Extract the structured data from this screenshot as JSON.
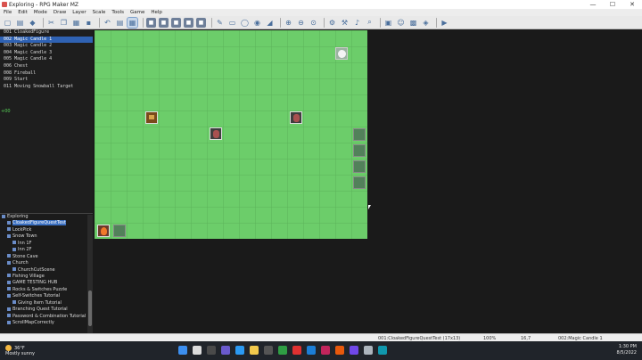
{
  "window": {
    "title": "Exploring - RPG Maker MZ",
    "controls": [
      "—",
      "☐",
      "✕"
    ]
  },
  "menu": [
    "File",
    "Edit",
    "Mode",
    "Draw",
    "Layer",
    "Scale",
    "Tools",
    "Game",
    "Help"
  ],
  "events": [
    "001 CloakedFigure",
    "002 Magic Candle 1",
    "003 Magic Candle 2",
    "004 Magic Candle 3",
    "005 Magic Candle 4",
    "006 Chest",
    "008 Fireball",
    "009 Start",
    "011 Moving Snowball Target"
  ],
  "green_marker": "+00",
  "maps": [
    {
      "label": "Exploring",
      "indent": 0
    },
    {
      "label": "CloakedFigureQuestTest",
      "indent": 1,
      "selected": true
    },
    {
      "label": "LockPick",
      "indent": 1
    },
    {
      "label": "Snow Town",
      "indent": 1
    },
    {
      "label": "Inn 1F",
      "indent": 2
    },
    {
      "label": "Inn 2F",
      "indent": 2
    },
    {
      "label": "Stone Cave",
      "indent": 1
    },
    {
      "label": "Church",
      "indent": 1
    },
    {
      "label": "ChurchCutScene",
      "indent": 2
    },
    {
      "label": "Fishing Village",
      "indent": 1
    },
    {
      "label": "GAME TESTING HUB",
      "indent": 1
    },
    {
      "label": "Rocks & Switches Puzzle",
      "indent": 1
    },
    {
      "label": "Self-Switches Tutorial",
      "indent": 1
    },
    {
      "label": "Giving Item Tutorial",
      "indent": 2
    },
    {
      "label": "Branching Quest Tutorial",
      "indent": 1
    },
    {
      "label": "Password & Combination Tutorial",
      "indent": 1
    },
    {
      "label": "ScrollMapCorrectly",
      "indent": 1
    }
  ],
  "status": {
    "map": "001:CloakedFigureQuestTest (17x13)",
    "zoom": "100%",
    "coords": "16,7",
    "event": "002:Magic Candle 1"
  },
  "weather": {
    "temp": "36°F",
    "desc": "Mostly sunny"
  },
  "clock": {
    "time": "1:30 PM",
    "date": "8/5/2022"
  }
}
